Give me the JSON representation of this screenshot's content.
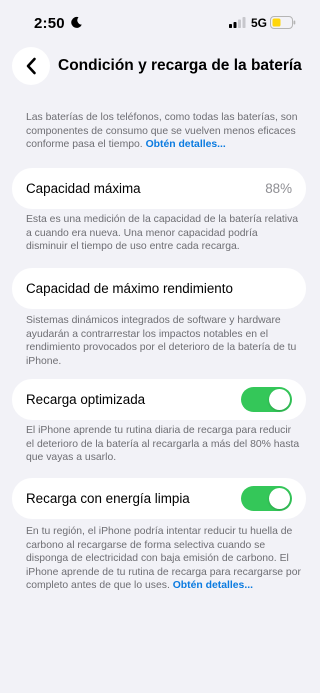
{
  "status_bar": {
    "time": "2:50",
    "network": "5G"
  },
  "nav": {
    "title": "Condición y recarga de la batería"
  },
  "intro": {
    "text": "Las baterías de los teléfonos, como todas las baterías, son componentes de consumo que se vuelven menos eficaces conforme pasa el tiempo. ",
    "link": "Obtén detalles..."
  },
  "max_capacity": {
    "label": "Capacidad máxima",
    "value": "88%",
    "description": "Esta es una medición de la capacidad de la batería relativa a cuando era nueva. Una menor capacidad podría disminuir el tiempo de uso entre cada recarga."
  },
  "peak_performance": {
    "label": "Capacidad de máximo rendimiento",
    "description": "Sistemas dinámicos integrados de software y hardware ayudarán a contrarrestar los impactos notables en el rendimiento provocados por el deterioro de la batería de tu iPhone."
  },
  "optimized_charging": {
    "label": "Recarga optimizada",
    "enabled": true,
    "description": "El iPhone aprende tu rutina diaria de recarga para reducir el deterioro de la batería al recargarla a más del 80% hasta que vayas a usarlo."
  },
  "clean_energy": {
    "label": "Recarga con energía limpia",
    "enabled": true,
    "description": "En tu región, el iPhone podría intentar reducir tu huella de carbono al recargarse de forma selectiva cuando se disponga de electricidad con baja emisión de carbono. El iPhone aprende de tu rutina de recarga para recargarse por completo antes de que lo uses. ",
    "link": "Obtén detalles..."
  },
  "colors": {
    "background": "#f2f2f7",
    "toggle_on": "#34c759",
    "link": "#0b7be0",
    "secondary_text": "#6e6e73",
    "battery_fill": "#ffd60a"
  }
}
